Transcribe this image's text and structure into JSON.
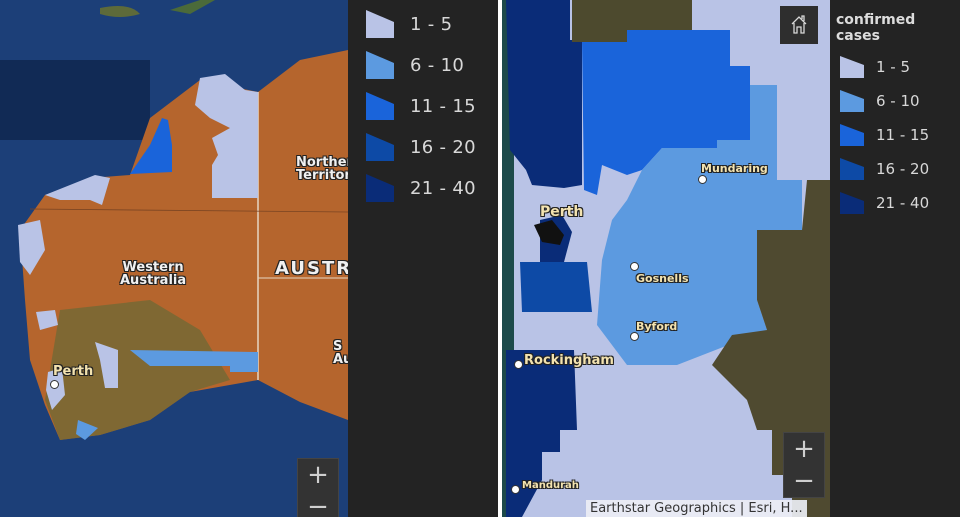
{
  "legend_classes": [
    {
      "label": "1 - 5",
      "color": "#b9c3e6"
    },
    {
      "label": "6 - 10",
      "color": "#5c9ae0"
    },
    {
      "label": "11 - 15",
      "color": "#1a64da"
    },
    {
      "label": "16 - 20",
      "color": "#0d4aa6"
    },
    {
      "label": "21 - 40",
      "color": "#0a2c78"
    }
  ],
  "left_map": {
    "labels": {
      "northern_territory": "Northern Territory",
      "northern_territory_line1": "Norther",
      "northern_territory_line2": "Territor",
      "western_australia_line1": "Western",
      "western_australia_line2": "Australia",
      "australia": "AUSTR",
      "south_australia_partial1": "S",
      "south_australia_partial2": "Au",
      "perth": "Perth"
    },
    "zoom_in_label": "+",
    "zoom_out_label": "−"
  },
  "right_map": {
    "legend_title": "confirmed cases",
    "labels": {
      "perth": "Perth",
      "mundaring": "Mundaring",
      "gosnells": "Gosnells",
      "byford": "Byford",
      "rockingham": "Rockingham",
      "mandurah": "Mandurah"
    },
    "home_icon": "home-icon",
    "zoom_in_label": "+",
    "zoom_out_label": "−",
    "attribution": "Earthstar Geographics | Esri, H..."
  }
}
